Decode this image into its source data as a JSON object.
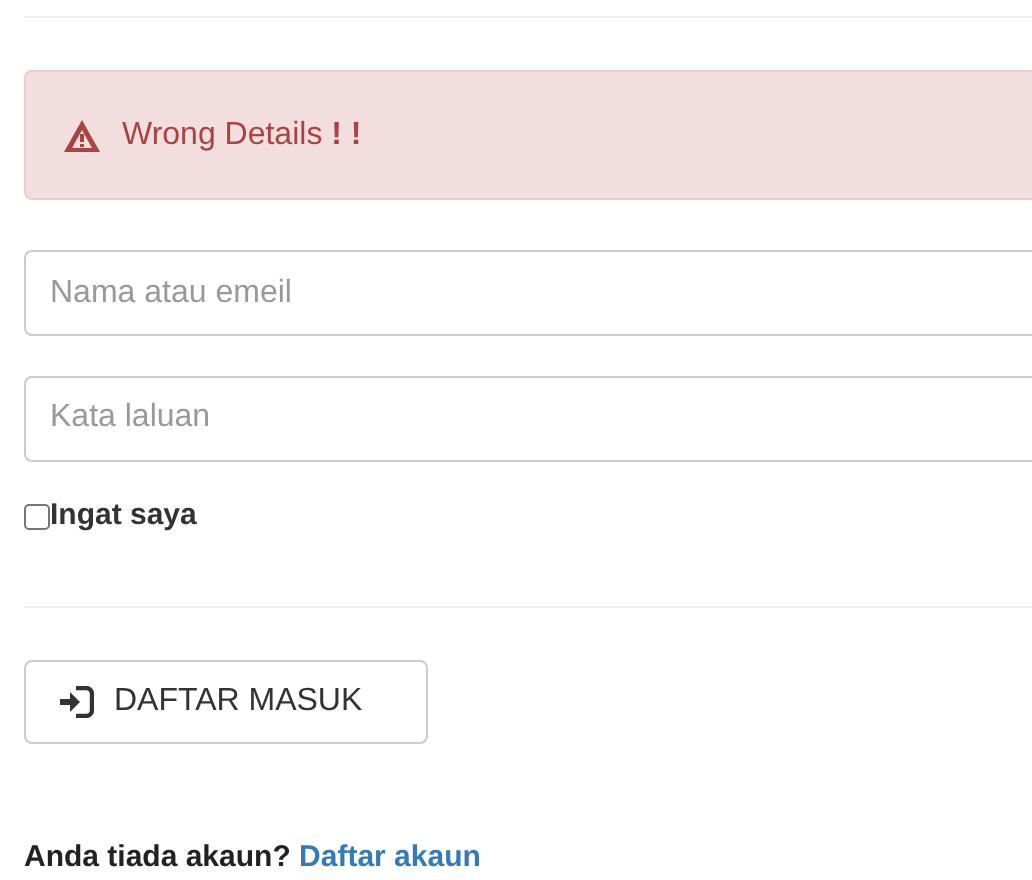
{
  "alert": {
    "text": "Wrong Details",
    "emphasis": "! !"
  },
  "fields": [
    {
      "placeholder": "Nama atau emeil"
    },
    {
      "placeholder": "Kata laluan"
    }
  ],
  "remember": {
    "label": "Ingat saya",
    "checked": false
  },
  "login_button": {
    "label": "DAFTAR MASUK"
  },
  "signup": {
    "prompt": "Anda tiada akaun?",
    "link": "Daftar akaun"
  }
}
